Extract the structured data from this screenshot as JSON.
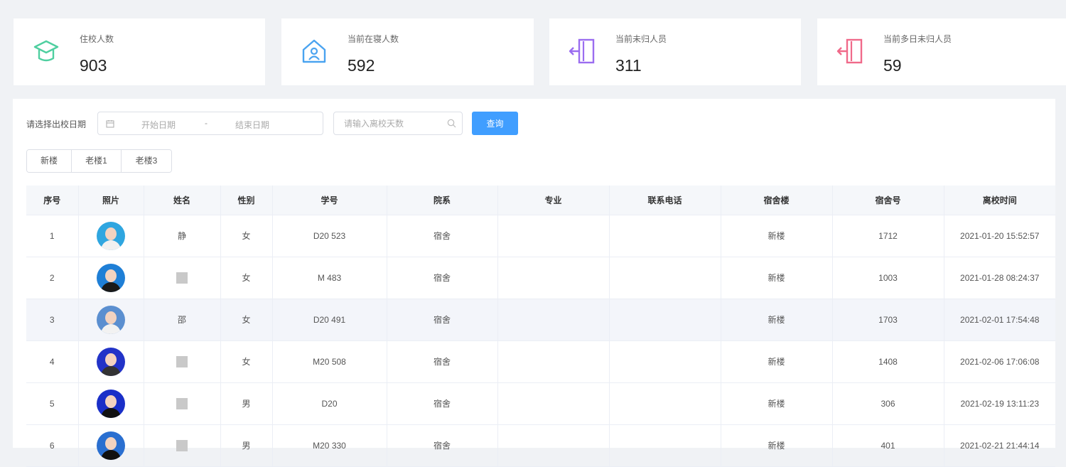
{
  "stats": [
    {
      "label": "住校人数",
      "value": "903",
      "icon": "graduation-cap-icon",
      "color": "#4fcfa0"
    },
    {
      "label": "当前在寝人数",
      "value": "592",
      "icon": "home-person-icon",
      "color": "#4aa3f0"
    },
    {
      "label": "当前未归人员",
      "value": "311",
      "icon": "door-enter-icon",
      "color": "#9b6df0"
    },
    {
      "label": "当前多日未归人员",
      "value": "59",
      "icon": "door-enter-icon",
      "color": "#f06a8a"
    }
  ],
  "filter": {
    "date_label": "请选择出校日期",
    "start_placeholder": "开始日期",
    "separator": "-",
    "end_placeholder": "结束日期",
    "days_placeholder": "请输入离校天数",
    "query_label": "查询"
  },
  "tabs": [
    "新楼",
    "老楼1",
    "老楼3"
  ],
  "table": {
    "headers": [
      "序号",
      "照片",
      "姓名",
      "性别",
      "学号",
      "院系",
      "专业",
      "联系电话",
      "宿舍楼",
      "宿舍号",
      "离校时间"
    ],
    "rows": [
      {
        "no": "1",
        "name": "静",
        "gender": "女",
        "student_id": "D20   523",
        "dept": "宿舍",
        "major": "",
        "phone": "",
        "building": "新楼",
        "room": "1712",
        "time": "2021-01-20 15:52:57",
        "avatar_bg": "#2fa6e0",
        "shirt": "#f0f0f0"
      },
      {
        "no": "2",
        "name": "",
        "gender": "女",
        "student_id": "M     483",
        "dept": "宿舍",
        "major": "",
        "phone": "",
        "building": "新楼",
        "room": "1003",
        "time": "2021-01-28 08:24:37",
        "avatar_bg": "#1f7fd6",
        "shirt": "#1a1a1a"
      },
      {
        "no": "3",
        "name": "邵",
        "gender": "女",
        "student_id": "D20  491",
        "dept": "宿舍",
        "major": "",
        "phone": "",
        "building": "新楼",
        "room": "1703",
        "time": "2021-02-01 17:54:48",
        "avatar_bg": "#5b8fd0",
        "shirt": "#f2f2f2"
      },
      {
        "no": "4",
        "name": "",
        "gender": "女",
        "student_id": "M20   508",
        "dept": "宿舍",
        "major": "",
        "phone": "",
        "building": "新楼",
        "room": "1408",
        "time": "2021-02-06 17:06:08",
        "avatar_bg": "#2233c8",
        "shirt": "#333"
      },
      {
        "no": "5",
        "name": "",
        "gender": "男",
        "student_id": "D20",
        "dept": "宿舍",
        "major": "",
        "phone": "",
        "building": "新楼",
        "room": "306",
        "time": "2021-02-19 13:11:23",
        "avatar_bg": "#1a2fc8",
        "shirt": "#111"
      },
      {
        "no": "6",
        "name": "",
        "gender": "男",
        "student_id": "M20   330",
        "dept": "宿舍",
        "major": "",
        "phone": "",
        "building": "新楼",
        "room": "401",
        "time": "2021-02-21 21:44:14",
        "avatar_bg": "#2a6fd0",
        "shirt": "#111"
      }
    ]
  }
}
